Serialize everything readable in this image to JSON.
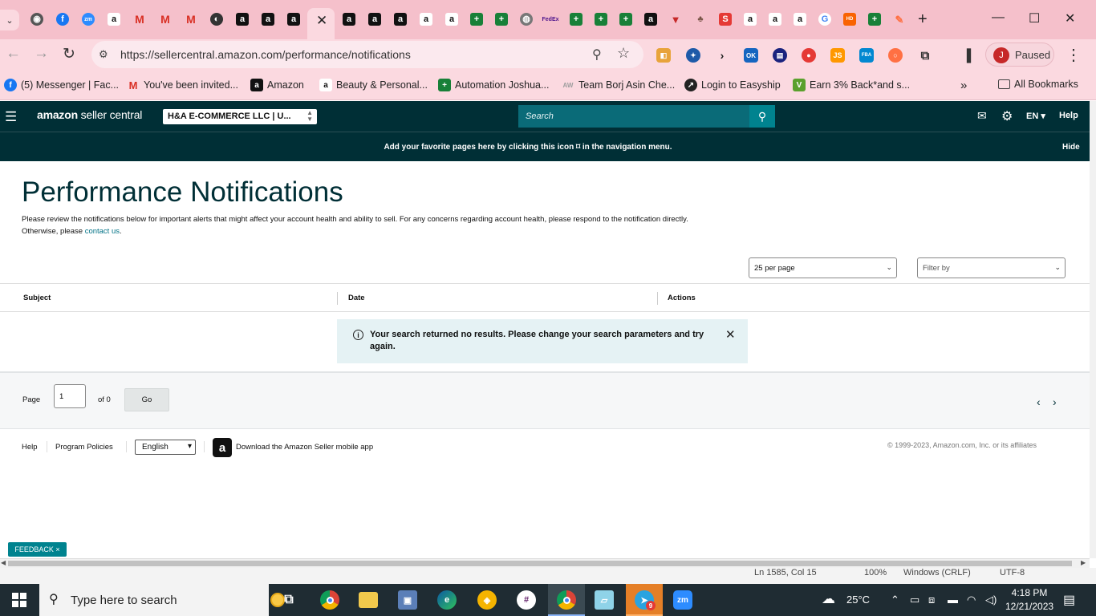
{
  "browser": {
    "tab_close": "✕",
    "new_tab": "+",
    "url": "https://sellercentral.amazon.com/performance/notifications",
    "profile_initial": "J",
    "profile_status": "Paused",
    "bookmarks": [
      {
        "label": "(5) Messenger | Fac...",
        "icon": "facebook-icon",
        "color": "#1877f2"
      },
      {
        "label": "You've been invited...",
        "icon": "gmail-icon",
        "color": "#d93025"
      },
      {
        "label": "Amazon",
        "icon": "amazon-icon",
        "color": "#111111"
      },
      {
        "label": "Beauty & Personal...",
        "icon": "amazon-icon",
        "color": "#ffffff"
      },
      {
        "label": "Automation Joshua...",
        "icon": "sheets-icon",
        "color": "#188038"
      },
      {
        "label": "Team Borj Asin Che...",
        "icon": "sheet-icon",
        "color": "#9e9e9e"
      },
      {
        "label": "Login to Easyship",
        "icon": "easyship-icon",
        "color": "#222222"
      },
      {
        "label": "Earn 3% Back*and s...",
        "icon": "earn-icon",
        "color": "#5aa02c"
      }
    ],
    "all_bookmarks": "All Bookmarks"
  },
  "seller_central": {
    "logo_brand": "amazon",
    "logo_product": " seller central",
    "account": "H&A E-COMMERCE LLC | U...",
    "search_placeholder": "Search",
    "language": "EN",
    "help": "Help",
    "banner_message": "Add your favorite pages here by clicking this icon ⌑ in the navigation menu.",
    "banner_hide": "Hide"
  },
  "page": {
    "title": "Performance Notifications",
    "description": "Please review the notifications below for important alerts that might affect your account health and ability to sell. For any concerns regarding account health, please respond to the notification directly. Otherwise, please ",
    "contact_link": "contact us",
    "description_end": ".",
    "per_page": "25 per page",
    "filter": "Filter by",
    "columns": [
      "Subject",
      "Date",
      "Actions"
    ],
    "alert_text": "Your search returned no results. Please change your search parameters and try again.",
    "pager": {
      "page_label": "Page",
      "page_value": "1",
      "of_label": "of 0",
      "go": "Go"
    }
  },
  "footer": {
    "help": "Help",
    "program_policies": "Program Policies",
    "language": "English",
    "download_app": "Download the Amazon Seller mobile app",
    "copyright": "© 1999-2023, Amazon.com, Inc. or its affiliates",
    "feedback": "FEEDBACK ×"
  },
  "editor_status": {
    "position": "Ln 1585, Col 15",
    "zoom": "100%",
    "line_ending": "Windows (CRLF)",
    "encoding": "UTF-8"
  },
  "taskbar": {
    "search_placeholder": "Type here to search",
    "temperature": "25°C",
    "time": "4:18 PM",
    "date": "12/21/2023",
    "telegram_badge": "9"
  }
}
